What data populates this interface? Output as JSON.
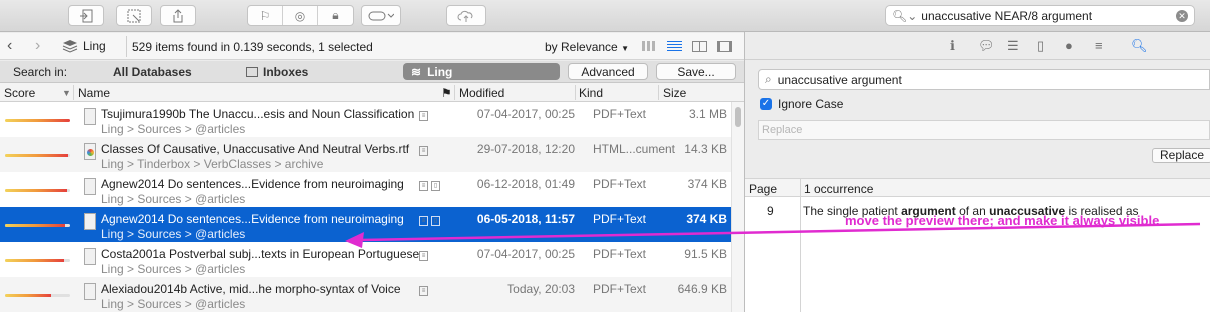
{
  "toolbar": {
    "search_value": "unaccusative NEAR/8 argument"
  },
  "pathbar": {
    "location": "Ling",
    "status": "529 items found in 0.139 seconds, 1 selected",
    "sort": "by Relevance"
  },
  "scope": {
    "label": "Search in:",
    "all_databases": "All Databases",
    "inboxes": "Inboxes",
    "ling": "Ling",
    "advanced": "Advanced",
    "save": "Save..."
  },
  "columns": {
    "score": "Score",
    "name": "Name",
    "modified": "Modified",
    "kind": "Kind",
    "size": "Size"
  },
  "rows": [
    {
      "title": "Tsujimura1990b The Unaccu...esis and Noun Classification",
      "path": "Ling > Sources > @articles",
      "modified": "07-04-2017, 00:25",
      "kind": "PDF+Text",
      "size": "3.1 MB",
      "relevance": 1.0,
      "icon": "doc-icon"
    },
    {
      "title": "Classes Of Causative, Unaccusative And Neutral Verbs.rtf",
      "path": "Ling > Tinderbox > VerbClasses > archive",
      "modified": "29-07-2018, 12:20",
      "kind": "HTML...cument",
      "size": "14.3 KB",
      "relevance": 0.97,
      "icon": "rtf-icon"
    },
    {
      "title": "Agnew2014 Do sentences...Evidence from neuroimaging",
      "path": "Ling > Sources > @articles",
      "modified": "06-12-2018, 01:49",
      "kind": "PDF+Text",
      "size": "374 KB",
      "relevance": 0.95,
      "icon": "doc-icon"
    },
    {
      "title": "Agnew2014 Do sentences...Evidence from neuroimaging",
      "path": "Ling > Sources > @articles",
      "modified": "06-05-2018, 11:57",
      "kind": "PDF+Text",
      "size": "374 KB",
      "relevance": 0.93,
      "icon": "doc-icon"
    },
    {
      "title": "Costa2001a Postverbal subj...texts in European Portuguese",
      "path": "Ling > Sources > @articles",
      "modified": "07-04-2017, 00:25",
      "kind": "PDF+Text",
      "size": "91.5 KB",
      "relevance": 0.9,
      "icon": "doc-icon"
    },
    {
      "title": "Alexiadou2014b Active, mid...he morpho-syntax of Voice",
      "path": "Ling > Sources > @articles",
      "modified": "Today, 20:03",
      "kind": "PDF+Text",
      "size": "646.9 KB",
      "relevance": 0.7,
      "icon": "doc-icon"
    }
  ],
  "inspector": {
    "find_value": "unaccusative argument",
    "ignore_case": "Ignore Case",
    "replace_placeholder": "Replace",
    "replace_button": "Replace",
    "col_page": "Page",
    "col_occurrence": "1 occurrence",
    "result_page": "9",
    "result_pre": "The single patient ",
    "result_hit1": "argument",
    "result_mid": " of an ",
    "result_hit2": "unaccusative",
    "result_post": " is realised as"
  },
  "annotation": {
    "text": "move the preview there; and make it always visible",
    "color": "#e02bd0"
  },
  "colors": {
    "selection": "#0b62d0",
    "accent": "#1a73e8"
  }
}
